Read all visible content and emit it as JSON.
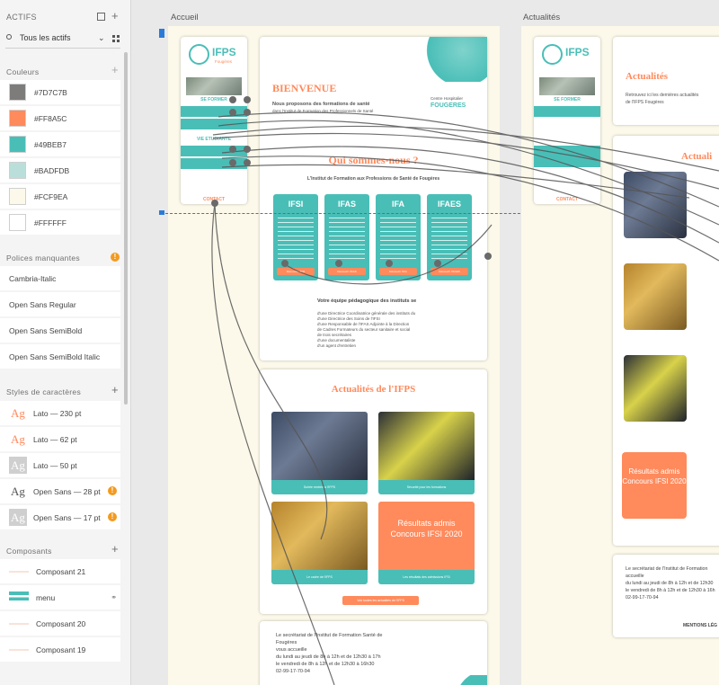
{
  "assets": {
    "title": "ACTIFS",
    "filter_label": "Tous les actifs",
    "sections": {
      "colors": "Couleurs",
      "missing_fonts": "Polices manquantes",
      "char_styles": "Styles de caractères",
      "components": "Composants"
    },
    "colors": [
      {
        "hex": "#7D7C7B",
        "label": "#7D7C7B"
      },
      {
        "hex": "#FF8A5C",
        "label": "#FF8A5C"
      },
      {
        "hex": "#49BEB7",
        "label": "#49BEB7"
      },
      {
        "hex": "#BADFDB",
        "label": "#BADFDB"
      },
      {
        "hex": "#FCF9EA",
        "label": "#FCF9EA"
      },
      {
        "hex": "#FFFFFF",
        "label": "#FFFFFF"
      }
    ],
    "missing_fonts": [
      "Cambria-Italic",
      "Open Sans Regular",
      "Open Sans SemiBold",
      "Open Sans SemiBold Italic"
    ],
    "char_styles": [
      {
        "sample": "Ag",
        "label": "Lato — 230 pt",
        "color": "#FF8A5C",
        "warning": false
      },
      {
        "sample": "Ag",
        "label": "Lato — 62 pt",
        "color": "#FF8A5C",
        "warning": false
      },
      {
        "sample": "Ag",
        "label": "Lato — 50 pt",
        "color": "#FFFFFF",
        "warning": false
      },
      {
        "sample": "Ag",
        "label": "Open Sans — 28 pt",
        "color": "#555555",
        "warning": true
      },
      {
        "sample": "Ag",
        "label": "Open Sans — 17 pt",
        "color": "#FFFFFF",
        "warning": true
      }
    ],
    "components": [
      "Composant 21",
      "menu",
      "Composant 20",
      "Composant 19"
    ]
  },
  "canvas": {
    "artboard_left_title": "Accueil",
    "artboard_right_title": "Actualités"
  },
  "page_accueil": {
    "logo_text": "IFPS",
    "logo_sub": "Fougères",
    "menu_se_former": "SE FORMER",
    "menu_vie_etudiante": "VIE ETUDIANTE",
    "menu_contact": "CONTACT",
    "welcome_title": "BIENVENUE",
    "welcome_line1": "Nous proposons des formations de santé",
    "welcome_line2": "dans l'Institut de Formation des Professionnels de Santé",
    "partner_logo_line1": "Centre Hospitalier",
    "partner_logo_line2": "FOUGERES",
    "qui_title": "Qui sommes-nous ?",
    "qui_subtitle": "L'Institut de Formation aux Professions de Santé de Fougères",
    "schools": [
      "IFSI",
      "IFAS",
      "IFA",
      "IFAES"
    ],
    "school_buttons": [
      "Découvrir l'IFSI",
      "Découvrir l'IFAS",
      "Découvrir l'IFA",
      "Découvrir l'IFAES"
    ],
    "team_title": "Votre équipe pédagogique des instituts se",
    "team_lines": [
      "d'une Directrice Coordinatrice générale des instituts du",
      "d'une Directrice des Soins de l'IFSI",
      "d'une Responsable de l'IFAS Adjointe à la Direction",
      "de Cadres Formateurs du secteur sanitaire et social",
      "de trois secrétaires",
      "d'une documentaliste",
      "d'un agent d'entretien"
    ],
    "news_title": "Actualités de l'IFPS",
    "news_captions": [
      "Soirée rentrée à l'IFPS",
      "Sécurité pour les formations",
      "Le cadre de l'IFPS",
      "Les résultats des admissions IFSI"
    ],
    "results_card": "Résultats admis Concours IFSI 2020",
    "news_button": "Voir toutes les actualités de l'IFPS",
    "footer_line1": "Le secrétariat de l'Institut de Formation Santé de",
    "footer_line2": "Fougères",
    "footer_line3": "vous accueille",
    "footer_line4": "du lundi au jeudi de 8h à 12h et de 12h30 à 17h",
    "footer_line5": "le vendredi de 8h à 12h et de 12h30 à 16h30",
    "footer_phone": "02-99-17-70-94"
  },
  "page_actualites": {
    "title": "Actualités",
    "subtitle_line1": "Retrouvez ici les dernières actualités",
    "subtitle_line2": "de l'IFPS Fougères",
    "section_title": "Actuali",
    "item_titles": [
      "P",
      "La b",
      "Du n"
    ],
    "results_card": "Résultats admis Concours IFSI 2020",
    "footer_line1": "Le secrétariat de l'Institut de Formation",
    "footer_line2": "accueille",
    "footer_line3": "du lundi au jeudi de 8h à 12h et de 12h30",
    "footer_line4": "le vendredi de 8h à 12h et de 12h30 à 16h",
    "footer_phone": "02-99-17-70-94",
    "mentions": "MENTIONS LÉG"
  }
}
